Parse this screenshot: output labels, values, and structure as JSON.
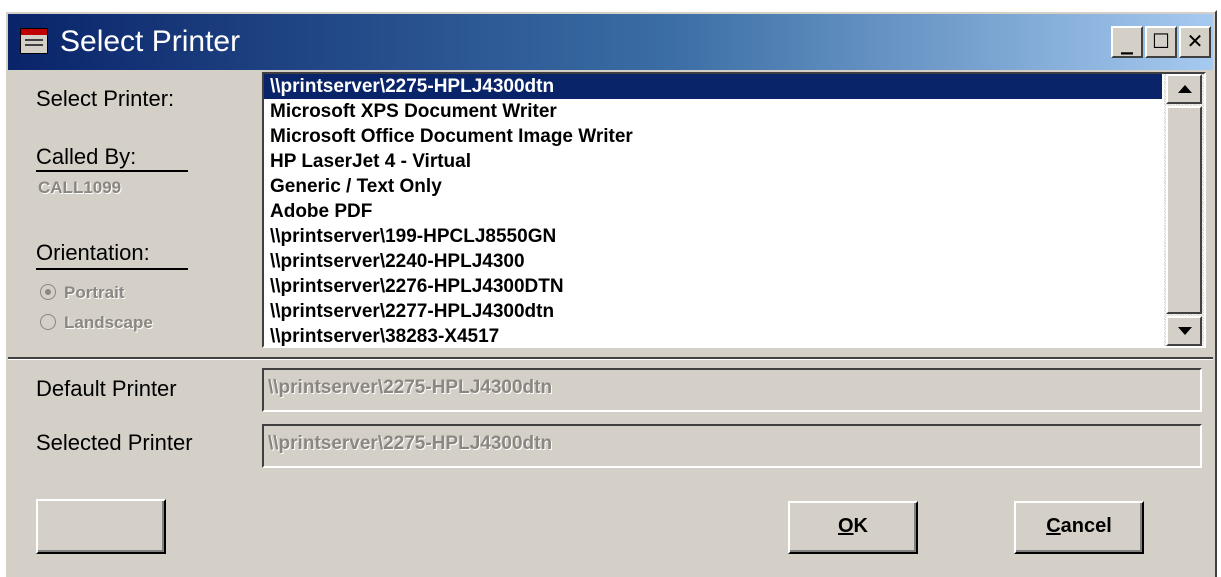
{
  "window": {
    "title": "Select Printer",
    "icon": "printer-dialog-icon",
    "controls": {
      "minimize": "_",
      "maximize": "☐",
      "close": "✕"
    }
  },
  "labels": {
    "select_printer": "Select Printer:",
    "called_by": "Called By:",
    "called_by_value": "CALL1099",
    "orientation": "Orientation:",
    "default_printer": "Default Printer",
    "selected_printer": "Selected Printer"
  },
  "orientation_options": [
    {
      "label": "Portrait",
      "checked": true
    },
    {
      "label": "Landscape",
      "checked": false
    }
  ],
  "printers": [
    "\\\\printserver\\2275-HPLJ4300dtn",
    "Microsoft XPS Document Writer",
    "Microsoft Office Document Image Writer",
    "HP LaserJet 4 - Virtual",
    "Generic / Text Only",
    "Adobe PDF",
    "\\\\printserver\\199-HPCLJ8550GN",
    "\\\\printserver\\2240-HPLJ4300",
    "\\\\printserver\\2276-HPLJ4300DTN",
    "\\\\printserver\\2277-HPLJ4300dtn",
    "\\\\printserver\\38283-X4517"
  ],
  "selected_index": 0,
  "fields": {
    "default_printer_value": "\\\\printserver\\2275-HPLJ4300dtn",
    "selected_printer_value": "\\\\printserver\\2275-HPLJ4300dtn"
  },
  "buttons": {
    "blank_label": "",
    "ok_mnemonic": "O",
    "ok_rest": "K",
    "cancel_mnemonic": "C",
    "cancel_rest": "ancel"
  },
  "colors": {
    "title_gradient_start": "#0a246a",
    "title_gradient_end": "#a6caf0",
    "face": "#d4d0c8",
    "selection": "#0a246a",
    "disabled_text": "#8a8680"
  }
}
